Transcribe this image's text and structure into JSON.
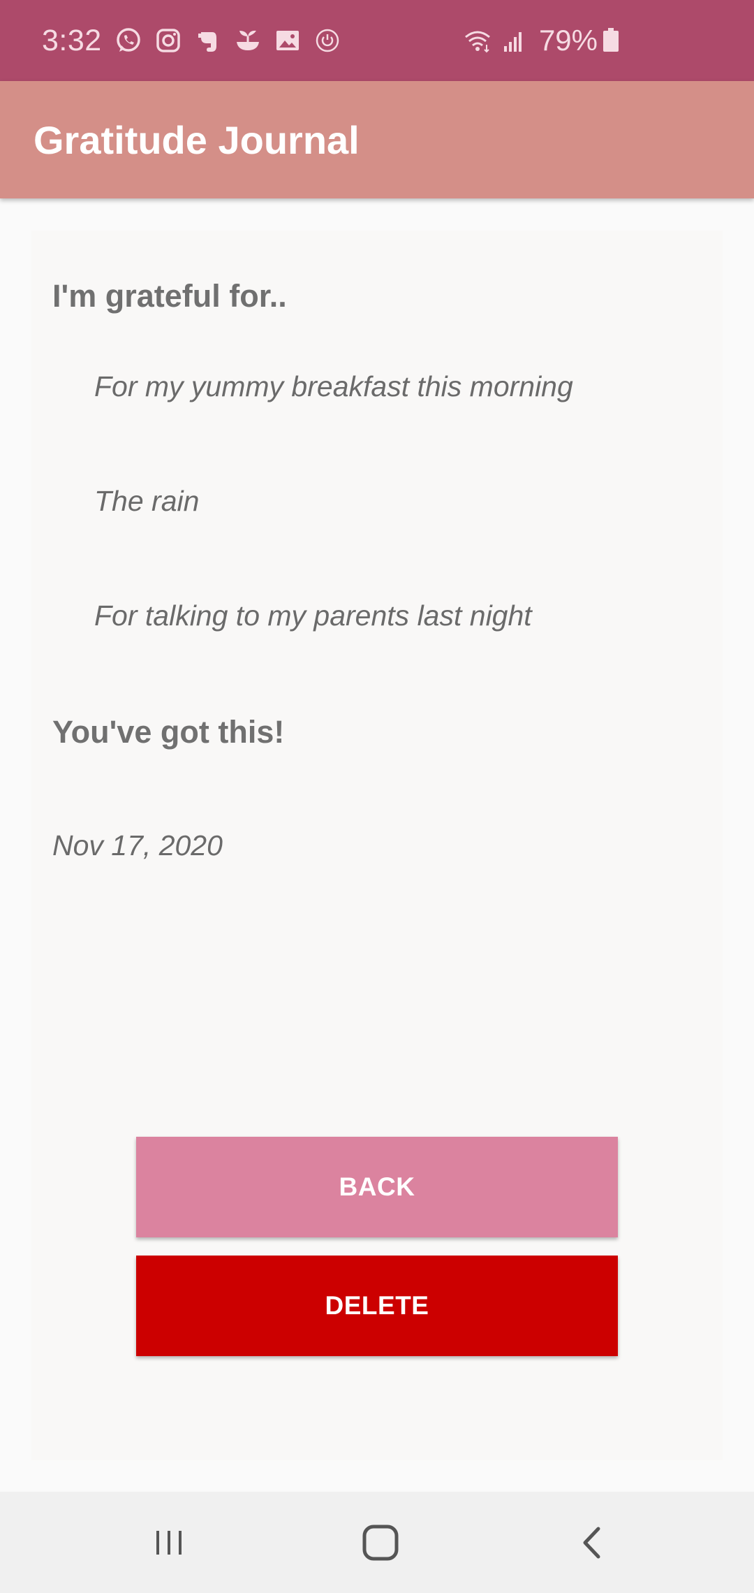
{
  "status_bar": {
    "time": "3:32",
    "battery_percent": "79%",
    "left_icons": [
      "whatsapp-icon",
      "instagram-icon",
      "evernote-icon",
      "sprout-icon",
      "gallery-icon",
      "power-icon"
    ],
    "right_icons": [
      "wifi-icon",
      "signal-icon",
      "battery-icon"
    ],
    "background_color": "#ad4a6a"
  },
  "app_bar": {
    "title": "Gratitude Journal",
    "background_color": "#d48f88"
  },
  "entry": {
    "grateful_heading": "I'm grateful for..",
    "items": [
      "For my yummy breakfast this morning",
      "The rain",
      "For talking to my parents last night"
    ],
    "affirmation": "You've got this!",
    "date": "Nov 17, 2020"
  },
  "actions": {
    "back_label": "BACK",
    "delete_label": "DELETE",
    "back_color": "#db839f",
    "delete_color": "#cc0000"
  },
  "nav_bar": {
    "buttons": [
      "recent-apps-icon",
      "home-icon",
      "back-icon"
    ]
  }
}
